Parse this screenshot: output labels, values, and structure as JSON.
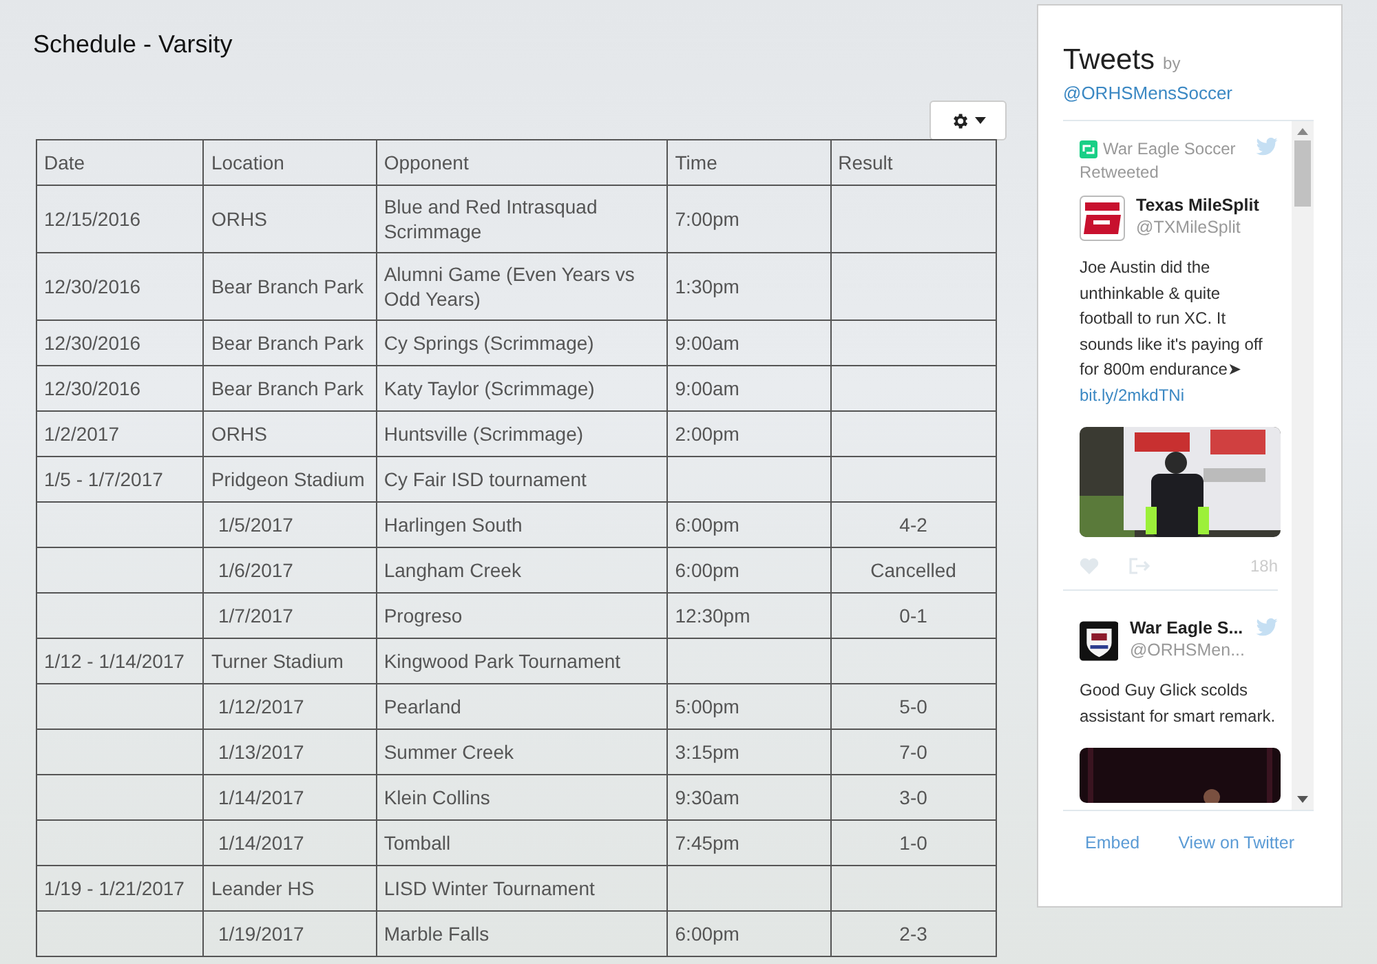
{
  "page": {
    "title": "Schedule - Varsity"
  },
  "schedule": {
    "columns": [
      "Date",
      "Location",
      "Opponent",
      "Time",
      "Result"
    ],
    "rows": [
      {
        "kind": "event",
        "date": "12/15/2016",
        "location": "ORHS",
        "opponent": "Blue and Red Intrasquad Scrimmage",
        "time": "7:00pm",
        "result": ""
      },
      {
        "kind": "event",
        "date": "12/30/2016",
        "location": "Bear Branch Park",
        "opponent": "Alumni Game (Even Years vs Odd Years)",
        "time": "1:30pm",
        "result": ""
      },
      {
        "kind": "event",
        "date": "12/30/2016",
        "location": "Bear Branch Park",
        "opponent": "Cy Springs (Scrimmage)",
        "time": "9:00am",
        "result": ""
      },
      {
        "kind": "event",
        "date": "12/30/2016",
        "location": "Bear Branch Park",
        "opponent": "Katy Taylor (Scrimmage)",
        "time": "9:00am",
        "result": ""
      },
      {
        "kind": "event",
        "date": "1/2/2017",
        "location": "ORHS",
        "opponent": "Huntsville (Scrimmage)",
        "time": "2:00pm",
        "result": ""
      },
      {
        "kind": "event",
        "date": "1/5 - 1/7/2017",
        "location": "Pridgeon Stadium",
        "opponent": "Cy Fair ISD tournament",
        "time": "",
        "result": ""
      },
      {
        "kind": "game",
        "date": "",
        "location": "1/5/2017",
        "opponent": "Harlingen South",
        "time": "6:00pm",
        "result": "4-2"
      },
      {
        "kind": "game",
        "date": "",
        "location": "1/6/2017",
        "opponent": "Langham Creek",
        "time": "6:00pm",
        "result": "Cancelled"
      },
      {
        "kind": "game",
        "date": "",
        "location": "1/7/2017",
        "opponent": "Progreso",
        "time": "12:30pm",
        "result": "0-1"
      },
      {
        "kind": "event",
        "date": "1/12 - 1/14/2017",
        "location": "Turner Stadium",
        "opponent": "Kingwood Park Tournament",
        "time": "",
        "result": ""
      },
      {
        "kind": "game",
        "date": "",
        "location": "1/12/2017",
        "opponent": "Pearland",
        "time": "5:00pm",
        "result": "5-0"
      },
      {
        "kind": "game",
        "date": "",
        "location": "1/13/2017",
        "opponent": "Summer Creek",
        "time": "3:15pm",
        "result": "7-0"
      },
      {
        "kind": "game",
        "date": "",
        "location": "1/14/2017",
        "opponent": "Klein Collins",
        "time": "9:30am",
        "result": "3-0"
      },
      {
        "kind": "game",
        "date": "",
        "location": "1/14/2017",
        "opponent": "Tomball",
        "time": "7:45pm",
        "result": "1-0"
      },
      {
        "kind": "event",
        "date": "1/19 - 1/21/2017",
        "location": "Leander HS",
        "opponent": "LISD Winter Tournament",
        "time": "",
        "result": ""
      },
      {
        "kind": "game",
        "date": "",
        "location": "1/19/2017",
        "opponent": "Marble Falls",
        "time": "6:00pm",
        "result": "2-3"
      }
    ]
  },
  "twitter": {
    "title": "Tweets",
    "by": "by",
    "account": "@ORHSMensSoccer",
    "tweets": [
      {
        "kind": "retweet",
        "retweeted_by": "War Eagle Soccer",
        "retweeted_label": "Retweeted",
        "name": "Texas MileSplit",
        "handle": "@TXMileSplit",
        "text": "Joe Austin did the unthinkable & quite football to run XC. It sounds like it's paying off for 800m endurance➤",
        "link": "bit.ly/2mkdTNi",
        "time": "18h"
      },
      {
        "kind": "tweet",
        "name": "War Eagle S...",
        "handle": "@ORHSMen...",
        "text": "Good Guy Glick scolds assistant for smart remark."
      }
    ],
    "footer": [
      "Embed",
      "View on Twitter"
    ]
  }
}
